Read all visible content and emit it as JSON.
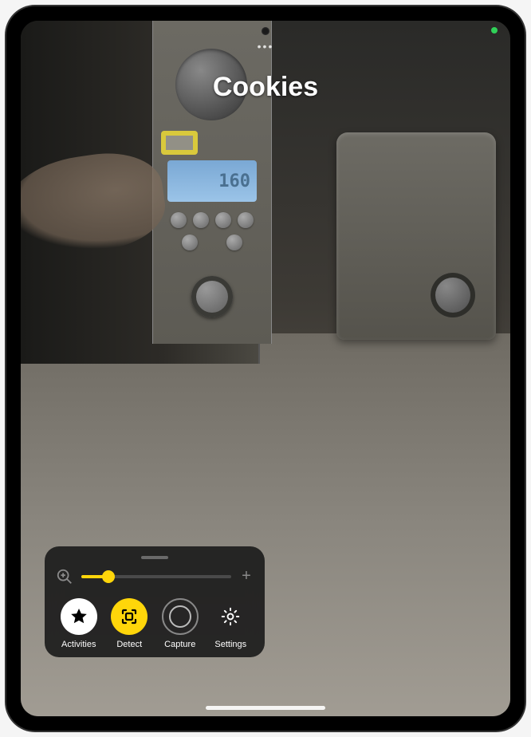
{
  "status": {
    "camera_active_color": "#30d158"
  },
  "detection": {
    "title": "Cookies",
    "highlighted_label": "Cookies",
    "lcd_value": "160"
  },
  "controls": {
    "zoom": {
      "percent": 18
    },
    "modes": [
      {
        "id": "activities",
        "label": "Activities",
        "icon": "star-icon",
        "state": "filled"
      },
      {
        "id": "detect",
        "label": "Detect",
        "icon": "detect-icon",
        "state": "active"
      },
      {
        "id": "capture",
        "label": "Capture",
        "icon": "capture-icon",
        "state": "ring"
      },
      {
        "id": "settings",
        "label": "Settings",
        "icon": "gear-icon",
        "state": "plain"
      }
    ]
  },
  "colors": {
    "accent": "#ffd60a",
    "panel_bg": "rgba(28,28,28,.92)"
  }
}
